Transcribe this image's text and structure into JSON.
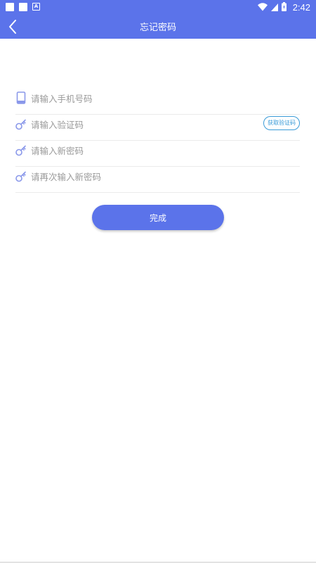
{
  "status_bar": {
    "time": "2:42",
    "left_icons": [
      "notification-square-icon",
      "notification-square-icon",
      "a-icon"
    ],
    "right_icons": [
      "wifi-icon",
      "cellular-signal-icon",
      "battery-icon"
    ],
    "a_label": "A"
  },
  "toolbar": {
    "title": "忘记密码",
    "back_icon": "chevron-left-icon",
    "background": "#5b73ea"
  },
  "form": {
    "phone": {
      "placeholder": "请输入手机号码",
      "value": "",
      "icon": "phone-icon"
    },
    "code": {
      "placeholder": "请输入验证码",
      "value": "",
      "icon": "key-icon",
      "button_label": "获取验证码"
    },
    "new_password": {
      "placeholder": "请输入新密码",
      "value": "",
      "icon": "key-icon"
    },
    "confirm_password": {
      "placeholder": "请再次输入新密码",
      "value": "",
      "icon": "key-icon"
    }
  },
  "submit": {
    "label": "完成"
  },
  "colors": {
    "primary": "#5b73ea",
    "icon": "#8a98ea",
    "code_button": "#3a9bd8",
    "divider": "#ebebeb"
  }
}
